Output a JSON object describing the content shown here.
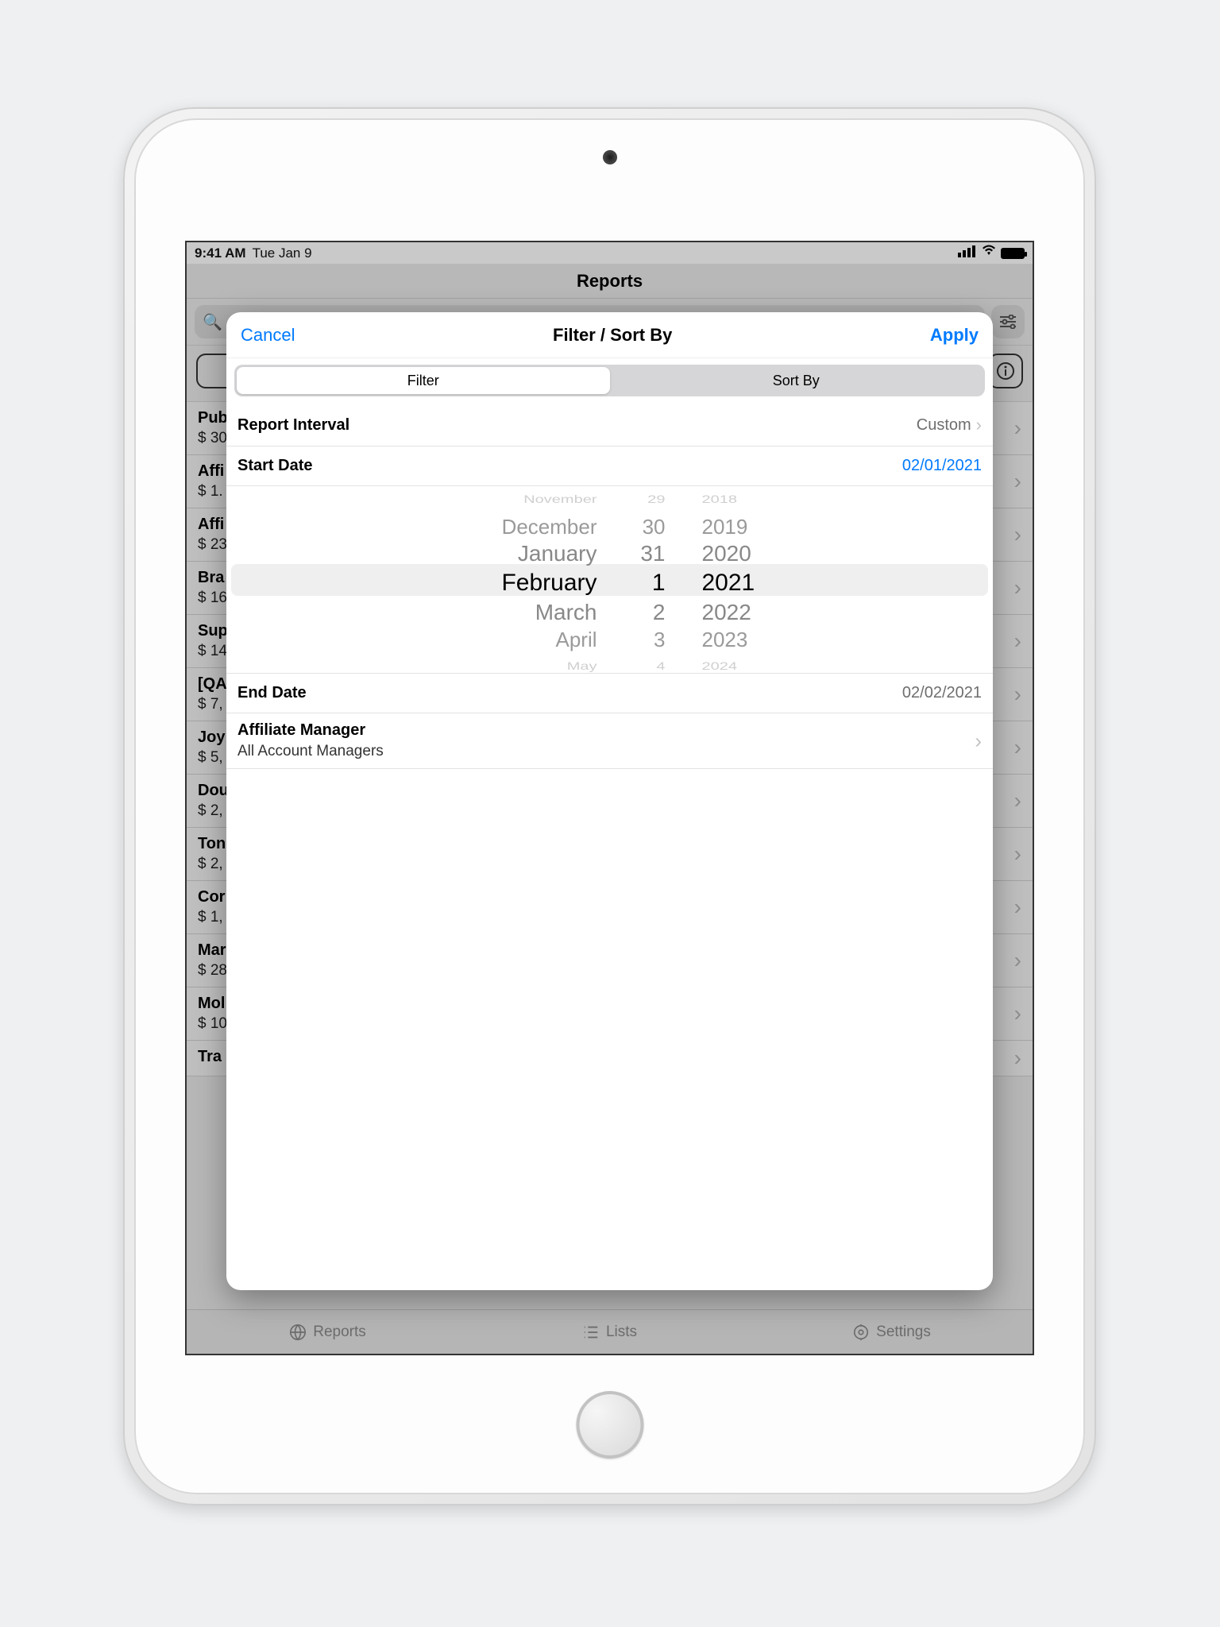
{
  "statusbar": {
    "time": "9:41 AM",
    "date": "Tue Jan 9"
  },
  "background": {
    "title": "Reports",
    "rows": [
      {
        "t": "Pub",
        "s": "$ 30"
      },
      {
        "t": "Affi",
        "s": "$ 1."
      },
      {
        "t": "Affi",
        "s": "$ 23"
      },
      {
        "t": "Bra",
        "s": "$ 16"
      },
      {
        "t": "Sup",
        "s": "$ 14"
      },
      {
        "t": "[QA",
        "s": "$ 7,"
      },
      {
        "t": "Joy",
        "s": "$ 5,"
      },
      {
        "t": "Dou",
        "s": "$ 2,"
      },
      {
        "t": "Ton",
        "s": "$ 2,"
      },
      {
        "t": "Cor",
        "s": "$ 1,"
      },
      {
        "t": "Mar",
        "s": "$ 28"
      },
      {
        "t": "Mol",
        "s": "$ 10"
      },
      {
        "t": "Tra",
        "s": ""
      }
    ],
    "tabs": {
      "reports": "Reports",
      "lists": "Lists",
      "settings": "Settings"
    }
  },
  "modal": {
    "cancel": "Cancel",
    "title": "Filter / Sort By",
    "apply": "Apply",
    "segments": {
      "filter": "Filter",
      "sortby": "Sort By"
    },
    "interval": {
      "label": "Report Interval",
      "value": "Custom"
    },
    "startDate": {
      "label": "Start Date",
      "value": "02/01/2021"
    },
    "endDate": {
      "label": "End Date",
      "value": "02/02/2021"
    },
    "affiliateManager": {
      "label": "Affiliate Manager",
      "value": "All Account Managers"
    },
    "picker": {
      "months": [
        "November",
        "December",
        "January",
        "February",
        "March",
        "April",
        "May"
      ],
      "days": [
        "29",
        "30",
        "31",
        "1",
        "2",
        "3",
        "4"
      ],
      "years": [
        "2018",
        "2019",
        "2020",
        "2021",
        "2022",
        "2023",
        "2024"
      ],
      "selIndex": 3
    }
  }
}
